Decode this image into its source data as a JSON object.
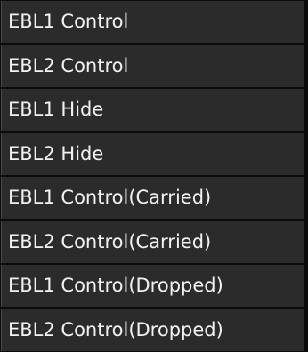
{
  "menu": {
    "items": [
      {
        "label": "EBL1 Control"
      },
      {
        "label": "EBL2 Control"
      },
      {
        "label": "EBL1 Hide"
      },
      {
        "label": "EBL2 Hide"
      },
      {
        "label": "EBL1 Control(Carried)"
      },
      {
        "label": "EBL2 Control(Carried)"
      },
      {
        "label": "EBL1 Control(Dropped)"
      },
      {
        "label": "EBL2 Control(Dropped)"
      }
    ]
  },
  "colors": {
    "background": "#0b0b0b",
    "item_background": "#2b2b2b",
    "text": "#f2f2f2"
  }
}
